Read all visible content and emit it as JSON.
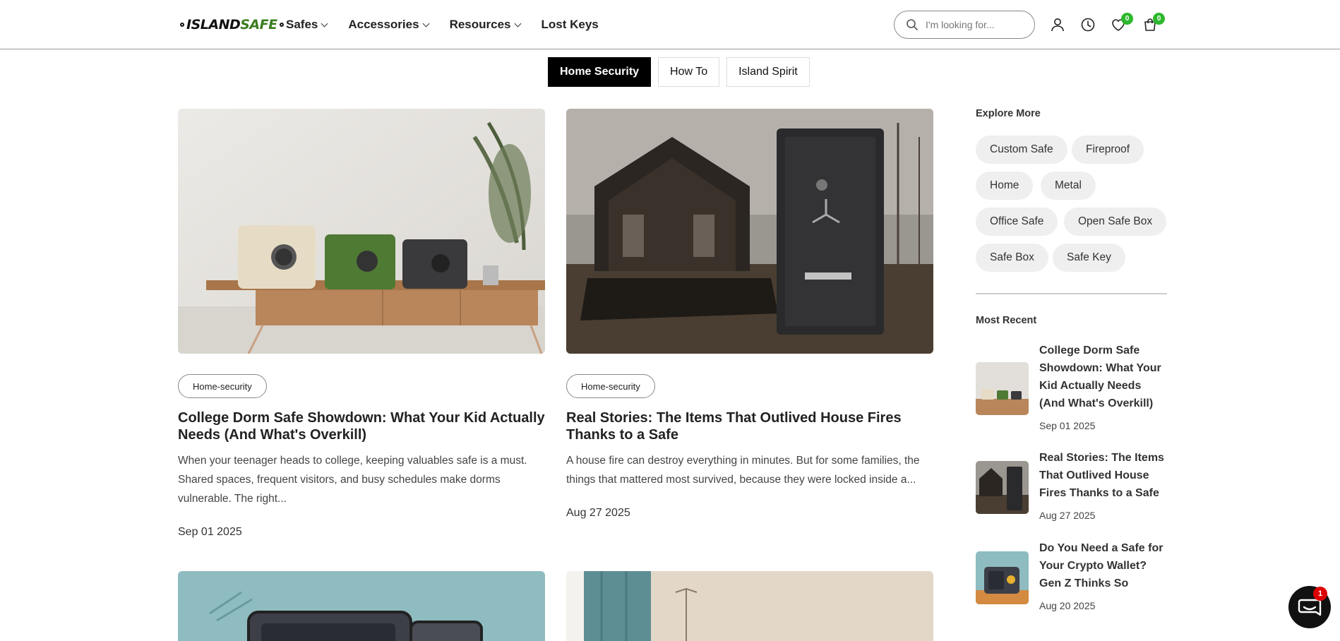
{
  "header": {
    "logo_island": "ISLAND",
    "logo_safe": "SAFE",
    "nav": [
      {
        "label": "Safes",
        "has_dropdown": true
      },
      {
        "label": "Accessories",
        "has_dropdown": true
      },
      {
        "label": "Resources",
        "has_dropdown": true
      },
      {
        "label": "Lost Keys",
        "has_dropdown": false
      }
    ],
    "search_placeholder": "I'm looking for...",
    "wishlist_count": "0",
    "cart_count": "0"
  },
  "tabs": [
    {
      "label": "Home Security",
      "active": true
    },
    {
      "label": "How To",
      "active": false
    },
    {
      "label": "Island Spirit",
      "active": false
    }
  ],
  "posts": [
    {
      "tag": "Home-security",
      "title": "College Dorm Safe Showdown: What Your Kid Actually Needs (And What's Overkill)",
      "excerpt": "When your teenager heads to college, keeping valuables safe is a must. Shared spaces, frequent visitors, and busy schedules make dorms vulnerable. The right...",
      "date": "Sep 01 2025"
    },
    {
      "tag": "Home-security",
      "title": "Real Stories: The Items That Outlived House Fires Thanks to a Safe",
      "excerpt": "A house fire can destroy everything in minutes. But for some families, the things that mattered most survived, because they were locked inside a...",
      "date": "Aug 27 2025"
    }
  ],
  "sidebar": {
    "explore_heading": "Explore More",
    "chips": [
      "Custom Safe",
      "Fireproof",
      "Home",
      "Metal",
      "Office Safe",
      "Open Safe Box",
      "Safe Box",
      "Safe Key"
    ],
    "recent_heading": "Most Recent",
    "recent": [
      {
        "title": "College Dorm Safe Showdown: What Your Kid Actually Needs (And What's Overkill)",
        "date": "Sep 01 2025"
      },
      {
        "title": "Real Stories: The Items That Outlived House Fires Thanks to a Safe",
        "date": "Aug 27 2025"
      },
      {
        "title": "Do You Need a Safe for Your Crypto Wallet? Gen Z Thinks So",
        "date": "Aug 20 2025"
      }
    ]
  },
  "chat": {
    "unread": "1"
  },
  "colors": {
    "accent": "#2cb82c",
    "brand_green": "#3a7d1f",
    "active_tab": "#000000"
  }
}
